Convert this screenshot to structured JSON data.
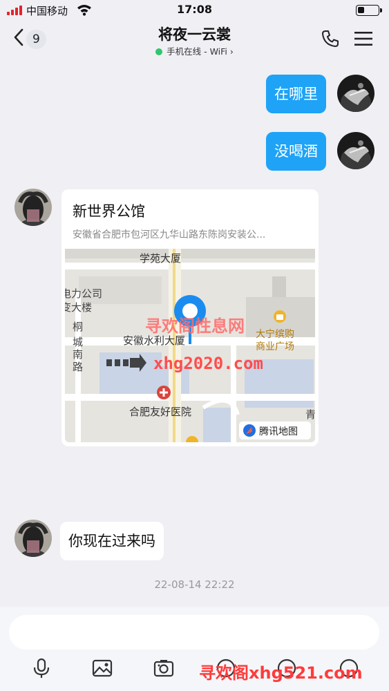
{
  "status_bar": {
    "carrier": "中国移动",
    "time": "17:08",
    "signal_color": "#e2242a"
  },
  "header": {
    "back_badge": "9",
    "title": "将夜一云裳",
    "subtitle": "手机在线 - WiFi ›",
    "online_color": "#2dc76d"
  },
  "messages": [
    {
      "sender": "self",
      "text": "在哪里"
    },
    {
      "sender": "self",
      "text": "没喝酒"
    },
    {
      "sender": "other",
      "type": "location",
      "name": "新世界公馆",
      "address": "安徽省合肥市包河区九华山路东陈岗安装公...",
      "map": {
        "labels": [
          "学苑大厦",
          "电力公司",
          "变大楼",
          "桐",
          "城",
          "南",
          "路",
          "安徽水利大厦",
          "大宁缤购",
          "商业广场",
          "合肥友好医院",
          "青"
        ],
        "provider": "腾讯地图"
      }
    },
    {
      "sender": "other",
      "text": "你现在过来吗"
    }
  ],
  "timestamp": "22-08-14 22:22",
  "watermarks": [
    "寻欢阁性息网",
    "xhg2020.com",
    "寻欢阁xhg521.com"
  ],
  "colors": {
    "accent": "#1ea3f7",
    "background": "#efeff4"
  },
  "icons": [
    "signal-icon",
    "wifi-icon",
    "battery-icon",
    "back-arrow-icon",
    "phone-icon",
    "menu-icon",
    "voice-icon",
    "image-icon",
    "camera-icon",
    "emoji-icon",
    "more-icon"
  ]
}
